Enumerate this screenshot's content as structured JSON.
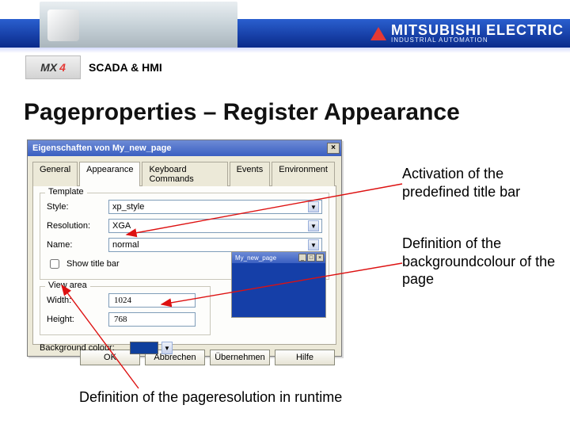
{
  "header": {
    "brand_top": "MITSUBISHI ELECTRIC",
    "brand_sub": "INDUSTRIAL AUTOMATION",
    "logo_main": "MX",
    "logo_num": "4",
    "subtitle": "SCADA & HMI"
  },
  "page_title": "Pageproperties – Register Appearance",
  "dialog": {
    "title": "Eigenschaften von My_new_page",
    "close_glyph": "×",
    "tabs": [
      "General",
      "Appearance",
      "Keyboard Commands",
      "Events",
      "Environment"
    ],
    "active_tab_index": 1,
    "template_group": "Template",
    "labels": {
      "style": "Style:",
      "resolution": "Resolution:",
      "name": "Name:",
      "show_title_bar": "Show title bar",
      "view_area": "View area",
      "width": "Width:",
      "height": "Height:",
      "bg": "Background colour:"
    },
    "values": {
      "style": "xp_style",
      "resolution": "XGA",
      "name": "normal",
      "width": "1024",
      "height": "768"
    },
    "preview_title": "My_new_page",
    "buttons": [
      "OK",
      "Abbrechen",
      "Übernehmen",
      "Hilfe"
    ]
  },
  "callouts": {
    "c1": "Activation of the predefined title bar",
    "c2": "Definition of the backgroundcolour of the page",
    "c3": "Definition of the pageresolution in runtime"
  }
}
